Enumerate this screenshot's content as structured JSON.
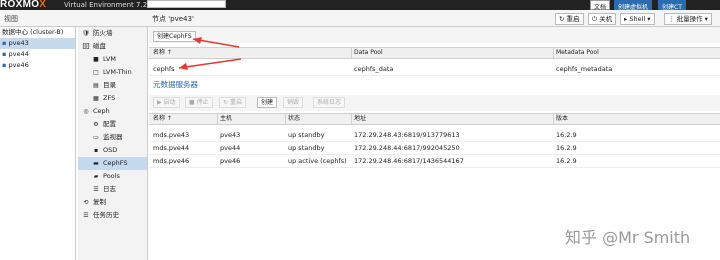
{
  "topbar": {
    "logo_pre": "ROXMO",
    "logo_x": "X",
    "version": "Virtual Environment 7.2-7",
    "doc_label": "文档",
    "create_vm_label": "创建虚拟机",
    "create_ct_label": "创建CT"
  },
  "header": {
    "view_label": "视图",
    "node_title": "节点 'pve43'",
    "buttons": {
      "reboot": "重启",
      "shutdown": "关机",
      "shell": "Shell",
      "bulk": "批量操作"
    }
  },
  "tree": {
    "items": [
      {
        "label": "数据中心 (cluster-B)",
        "selected": false
      },
      {
        "label": "pve43",
        "selected": true
      },
      {
        "label": "pve44",
        "selected": false
      },
      {
        "label": "pve46",
        "selected": false
      }
    ]
  },
  "menu": {
    "items": [
      {
        "icon": "🛡",
        "label": "防火墙",
        "indent": 0,
        "selected": false,
        "icon_name": "shield-icon"
      },
      {
        "icon": "🗄",
        "label": "磁盘",
        "indent": 0,
        "selected": false,
        "icon_name": "disk-icon"
      },
      {
        "icon": "■",
        "label": "LVM",
        "indent": 1,
        "selected": false,
        "icon_name": "lvm-icon"
      },
      {
        "icon": "□",
        "label": "LVM-Thin",
        "indent": 1,
        "selected": false,
        "icon_name": "lvm-thin-icon"
      },
      {
        "icon": "▤",
        "label": "目录",
        "indent": 1,
        "selected": false,
        "icon_name": "folder-icon"
      },
      {
        "icon": "▦",
        "label": "ZFS",
        "indent": 1,
        "selected": false,
        "icon_name": "zfs-icon"
      },
      {
        "icon": "◎",
        "label": "Ceph",
        "indent": 0,
        "selected": false,
        "icon_name": "ceph-icon"
      },
      {
        "icon": "⚙",
        "label": "配置",
        "indent": 1,
        "selected": false,
        "icon_name": "gear-icon"
      },
      {
        "icon": "▭",
        "label": "监视器",
        "indent": 1,
        "selected": false,
        "icon_name": "monitor-icon"
      },
      {
        "icon": "▪",
        "label": "OSD",
        "indent": 1,
        "selected": false,
        "icon_name": "osd-icon"
      },
      {
        "icon": "▬",
        "label": "CephFS",
        "indent": 1,
        "selected": true,
        "icon_name": "cephfs-icon"
      },
      {
        "icon": "▰",
        "label": "Pools",
        "indent": 1,
        "selected": false,
        "icon_name": "pools-icon"
      },
      {
        "icon": "☰",
        "label": "日志",
        "indent": 1,
        "selected": false,
        "icon_name": "log-icon"
      },
      {
        "icon": "⟲",
        "label": "复制",
        "indent": 0,
        "selected": false,
        "icon_name": "replication-icon"
      },
      {
        "icon": "☰",
        "label": "任务历史",
        "indent": 0,
        "selected": false,
        "icon_name": "task-history-icon"
      }
    ]
  },
  "cephfs": {
    "create_button": "创建CephFS",
    "columns": [
      "名称 ↑",
      "Data Pool",
      "Metadata Pool"
    ],
    "rows": [
      [
        "cephfs",
        "cephfs_data",
        "cephfs_metadata"
      ]
    ]
  },
  "mds": {
    "section_title": "元数据服务器",
    "buttons": {
      "start": "启动",
      "stop": "停止",
      "restart": "重启",
      "create": "创建",
      "destroy": "销毁",
      "syslog": "系统日志"
    },
    "columns": [
      "名称 ↑",
      "主机",
      "状态",
      "地址",
      "版本"
    ],
    "rows": [
      [
        "mds.pve43",
        "pve43",
        "up standby",
        "172.29.248.43:6819/913779613",
        "16.2.9"
      ],
      [
        "mds.pve44",
        "pve44",
        "up standby",
        "172.29.248.44:6817/992045250",
        "16.2.9"
      ],
      [
        "mds.pve46",
        "pve46",
        "up active (cephfs)",
        "172.29.248.46:6817/1436544167",
        "16.2.9"
      ]
    ]
  },
  "watermark": "知乎 @Mr Smith",
  "colors": {
    "accent": "#2b6cb0",
    "selection": "#c5d9ef",
    "arrow": "#e53935",
    "logo_x": "#e57000"
  }
}
